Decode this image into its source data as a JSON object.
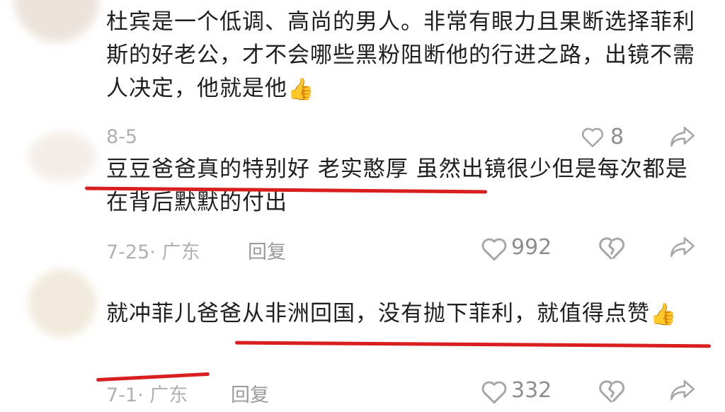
{
  "comments": [
    {
      "text": "杜宾是一个低调、高尚的男人。非常有眼力且果断选择菲利斯的好老公，才不会哪些黑粉阻断他的行进之路，出镜不需人决定，他就是他",
      "emoji": "👍",
      "date": "8-5",
      "likes": "8"
    },
    {
      "text": "豆豆爸爸真的特别好 老实憨厚 虽然出镜很少但是每次都是在背后默默的付出",
      "date": "7-25· 广东",
      "reply": "回复",
      "likes": "992"
    },
    {
      "text": "就冲菲儿爸爸从非洲回国，没有抛下菲利，就值得点赞",
      "emoji": "👍",
      "date": "7-1· 广东",
      "reply": "回复",
      "likes": "332"
    }
  ],
  "colors": {
    "annotation_red": "#d81e1e",
    "meta_gray": "#b0b0b0"
  }
}
